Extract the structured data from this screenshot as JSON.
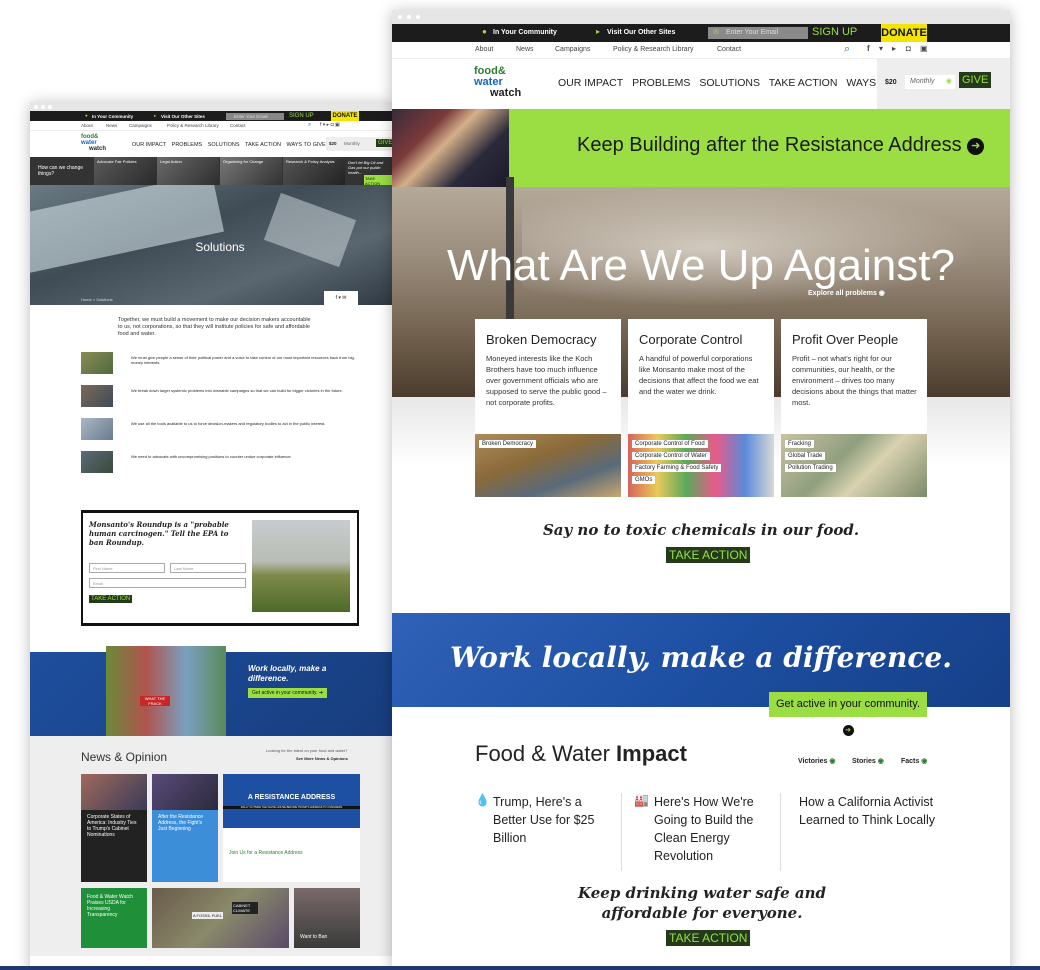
{
  "front": {
    "topbar": {
      "community": "In Your Community",
      "other_sites": "Visit Our Other Sites",
      "email_placeholder": "Enter Your Email",
      "signup": "SIGN UP",
      "donate": "DONATE"
    },
    "subnav": [
      "About",
      "News",
      "Campaigns",
      "Policy & Research Library",
      "Contact"
    ],
    "logo": {
      "line1": "food&",
      "line2": "water",
      "line3": "watch"
    },
    "mainnav": [
      "OUR IMPACT",
      "PROBLEMS",
      "SOLUTIONS",
      "TAKE ACTION",
      "WAYS TO GIVE"
    ],
    "give": {
      "amount": "$20",
      "freq": "Monthly",
      "button": "GIVE"
    },
    "banner": "Keep Building after the Resistance Address",
    "hero": {
      "title": "What Are We Up Against?",
      "link": "Explore all problems"
    },
    "cards": [
      {
        "title": "Broken Democracy",
        "text": "Moneyed interests like the Koch Brothers have too much influence over government officials who are supposed to serve the public good – not corporate profits.",
        "tags": [
          "Broken Democracy"
        ]
      },
      {
        "title": "Corporate Control",
        "text": "A handful of powerful corporations like Monsanto make most of the decisions that affect the food we eat and the water we drink.",
        "tags": [
          "Corporate Control of Food",
          "Corporate Control of Water",
          "Factory Farming & Food Safety",
          "GMOs"
        ]
      },
      {
        "title": "Profit Over People",
        "text": "Profit – not what's right for our communities, our health, or the environment – drives too many decisions about the things that matter most.",
        "tags": [
          "Fracking",
          "Global Trade",
          "Pollution Trading"
        ]
      }
    ],
    "cta1": {
      "text": "Say no to toxic chemicals in our food.",
      "button": "TAKE ACTION"
    },
    "local": {
      "title": "Work locally, make a difference.",
      "button": "Get active in your community."
    },
    "impact": {
      "title_light": "Food & Water",
      "title_bold": "Impact",
      "filters": [
        "Victories",
        "Stories",
        "Facts"
      ],
      "items": [
        "Trump, Here's a Better Use for $25 Billion",
        "Here's How We're Going to Build the Clean Energy Revolution",
        "How a California Activist Learned to Think Locally"
      ]
    },
    "cta2": {
      "text": "Keep drinking water safe and affordable for everyone.",
      "button": "TAKE ACTION"
    }
  },
  "back": {
    "topbar": {
      "community": "In Your Community",
      "other_sites": "Visit Our Other Sites",
      "email_placeholder": "Enter Your Email",
      "signup": "SIGN UP",
      "donate": "DONATE"
    },
    "subnav": [
      "About",
      "News",
      "Campaigns",
      "Policy & Research Library",
      "Contact"
    ],
    "mainnav": [
      "OUR IMPACT",
      "PROBLEMS",
      "SOLUTIONS",
      "TAKE ACTION",
      "WAYS TO GIVE"
    ],
    "give": {
      "amount": "$20",
      "freq": "Monthly",
      "button": "GIVE"
    },
    "strip": {
      "question": "How can we change things?",
      "items": [
        "Advocate Fair Policies",
        "Legal Action",
        "Organizing for Change",
        "Research & Policy Analysis"
      ],
      "quote": "Don't let Big Oil and Gas put our public health...",
      "button": "TAKE ACTION"
    },
    "hero_title": "Solutions",
    "breadcrumb": "Home  >  Solutions",
    "intro": "Together, we must build a movement to make our decision makers accountable to us, not corporations, so that they will institute policies for safe and affordable food and water.",
    "list": [
      "We must give people a sense of their political power and a voice to take control of our most important resources back from big-money interests.",
      "We break down larger systemic problems into winnable campaigns so that we can build for bigger victories in the future.",
      "We use all the tools available to us to force decision-makers and regulatory bodies to act in the public interest.",
      "We need to advocate with uncompromising positions to counter undue corporate influence."
    ],
    "form": {
      "headline": "Monsanto's Roundup is a \"probable human carcinogen.\" Tell the EPA to ban Roundup.",
      "first": "First Name",
      "last": "Last Name",
      "email": "Email",
      "button": "TAKE ACTION"
    },
    "local": {
      "title": "Work locally, make a difference.",
      "button": "Get active in your community."
    },
    "news": {
      "title": "News & Opinion",
      "aside": "Looking for the latest on your food and water?",
      "more": "See More News & Opinions",
      "items": [
        "Corporate States of America: Industry Ties to Trump's Cabinet Nominations",
        "After the Resistance Address, the Fight's Just Beginning",
        "Join Us for a Resistance Address",
        "Food & Water Watch Praises USDA for Increasing Transparency"
      ],
      "resistance_banner": "A RESISTANCE ADDRESS",
      "resistance_sub": "RALLY OUTSIDE THE WHITE HOUSE BEFORE TRUMP'S ADDRESS TO CONGRESS",
      "sign1": "A FOSSIL FUEL",
      "sign2": "CABINET CLIMATE",
      "sign3": "WHAT THE FRACK",
      "want": "Want to Ban"
    }
  },
  "colors": {
    "lime": "#9ade43",
    "dark": "#1c1c1c",
    "blue": "#1d4fa2",
    "yellow": "#f4e500"
  }
}
